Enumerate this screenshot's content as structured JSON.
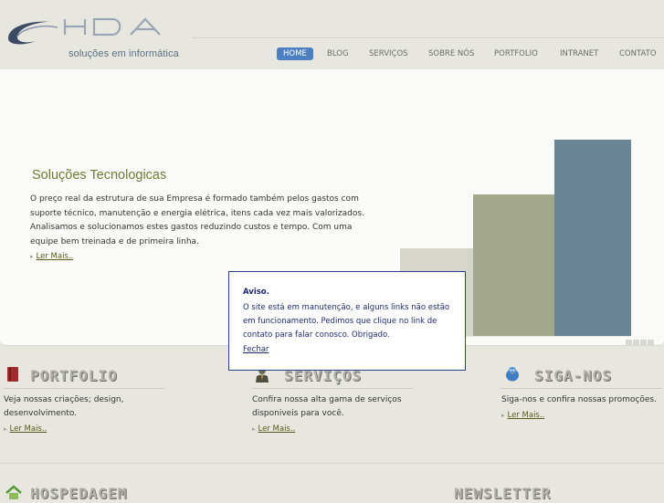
{
  "brand": {
    "name": "HDA",
    "subtitle": "soluções em informática"
  },
  "nav": {
    "items": [
      {
        "label": "HOME",
        "active": true
      },
      {
        "label": "BLOG",
        "active": false
      },
      {
        "label": "SERVIÇOS",
        "active": false
      },
      {
        "label": "SOBRE NÓS",
        "active": false
      },
      {
        "label": "PORTFOLIO",
        "active": false
      },
      {
        "label": "INTRANET",
        "active": false
      },
      {
        "label": "CONTATO",
        "active": false
      }
    ]
  },
  "hero": {
    "title": "Soluções Tecnologicas",
    "paragraph1": "O preço real da estrutura de sua Empresa é formado também pelos gastos com suporte técnico, manutenção e energia elétrica, itens cada vez mais valorizados.",
    "paragraph2": "Analisamos e solucionamos estes gastos reduzindo custos e tempo. Com uma equipe bem treinada e de primeira linha.",
    "more": "Ler Mais..",
    "slides": 4
  },
  "popup": {
    "title": "Aviso.",
    "text": "O site está em manutenção, e alguns links não estão em funcionamento. Pedimos que clique no link de contato para falar conosco. Obrigado.",
    "close": "Fechar"
  },
  "features": [
    {
      "icon": "book-icon",
      "title": "PORTFOLIO",
      "text": "Veja nossas criações; design, desenvolvimento.",
      "more": "Ler Mais.."
    },
    {
      "icon": "person-icon",
      "title": "SERVIÇOS",
      "text": "Confira nossa alta gama de serviços disponiveis para você.",
      "more": "Ler Mais.."
    },
    {
      "icon": "twitter-bird-icon",
      "title": "SIGA-NOS",
      "text": "Siga-nos e confira nossas promoções.",
      "more": "Ler Mais.."
    }
  ],
  "lower": {
    "left_title": "HOSPEDAGEM",
    "left_icon": "house-icon",
    "right_title": "NEWSLETTER"
  },
  "colors": {
    "accent": "#4d7fc3",
    "hero_title": "#6f7a33",
    "popup_border": "#2b3f8f"
  }
}
